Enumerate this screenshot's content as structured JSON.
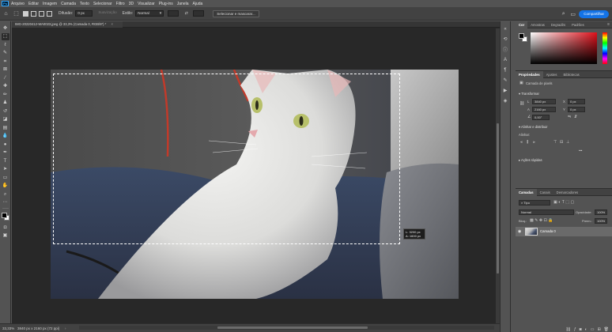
{
  "app": {
    "logo": "Ps",
    "menu": [
      "Arquivo",
      "Editar",
      "Imagem",
      "Camada",
      "Texto",
      "Selecionar",
      "Filtro",
      "3D",
      "Visualizar",
      "Plug-ins",
      "Janela",
      "Ajuda"
    ]
  },
  "options_bar": {
    "difusao_label": "Difusão:",
    "difusao_value": "0 px",
    "suavizacao_label": "Suavização",
    "estilo_label": "Estilo:",
    "estilo_value": "Normal",
    "select_mask_button": "Selecionar e mascarar...",
    "share_button": "Compartilhar",
    "icons": [
      "home-icon",
      "marquee-tool-icon",
      "new-selection-icon",
      "add-selection-icon",
      "subtract-selection-icon",
      "intersect-selection-icon",
      "search-icon",
      "workspace-icon",
      "share-icon"
    ]
  },
  "document": {
    "tab_title": "IMG-20220412-WA0023.jpeg @ 33,3% (Camada 0, RGB/8*) *",
    "tab_close": "×",
    "readout_width": "L: 3200 px",
    "readout_height": "A: 1600 px"
  },
  "status_bar": {
    "zoom": "33,33%",
    "doc_info": "3840 px x 2160 px (72 ppi)",
    "arrow": "›"
  },
  "color_panel": {
    "tabs": [
      "Cor",
      "Amostras",
      "Degradês",
      "Padrões"
    ],
    "active_tab": 0,
    "menu": "≡"
  },
  "properties_panel": {
    "tabs": [
      "Propriedades",
      "Ajustes",
      "Bibliotecas"
    ],
    "active_tab": 0,
    "layer_type": "Camada de pixels",
    "transform_heading": "Transformar",
    "w_label": "L",
    "w_value": "3840 px",
    "h_label": "A",
    "h_value": "2160 px",
    "x_label": "X",
    "x_value": "0 px",
    "y_label": "Y",
    "y_value": "0 px",
    "angle_value": "0,00°",
    "align_heading": "Alinhar e distribuir",
    "align_label": "Alinhar:",
    "quick_actions_heading": "Ações rápidas",
    "more": "•••"
  },
  "layers_panel": {
    "tabs": [
      "Camadas",
      "Canais",
      "Demarcadores"
    ],
    "active_tab": 0,
    "search_value": "Tipo",
    "blend_mode": "Normal",
    "opacity_label": "Opacidade:",
    "opacity_value": "100%",
    "lock_label": "Bloq.:",
    "fill_label": "Preen.:",
    "fill_value": "100%",
    "layers": [
      {
        "name": "Camada 0",
        "visible": true,
        "selected": true
      }
    ],
    "footer_icons": [
      "link-icon",
      "fx-icon",
      "mask-icon",
      "adjustment-icon",
      "group-icon",
      "new-layer-icon",
      "trash-icon"
    ]
  }
}
